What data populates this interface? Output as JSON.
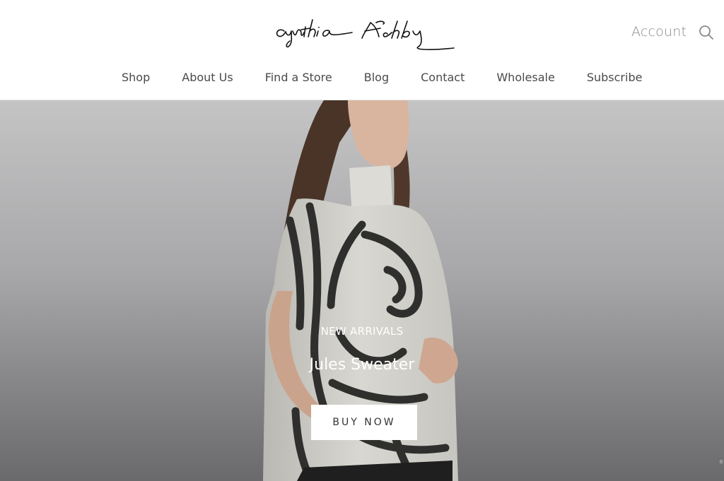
{
  "brand": {
    "logo_text": "cynthia Ashby"
  },
  "header": {
    "account_label": "Account",
    "search_icon": "search-icon"
  },
  "nav": {
    "items": [
      {
        "label": "Shop"
      },
      {
        "label": "About Us"
      },
      {
        "label": "Find a Store"
      },
      {
        "label": "Blog"
      },
      {
        "label": "Contact"
      },
      {
        "label": "Wholesale"
      },
      {
        "label": "Subscribe"
      }
    ]
  },
  "hero": {
    "eyebrow": "NEW ARRIVALS",
    "title": "Jules Sweater",
    "cta_label": "BUY NOW",
    "image_description": "model-wearing-printed-sweater",
    "colors": {
      "text": "#ffffff",
      "cta_background": "#ffffff",
      "cta_text": "#333333"
    }
  },
  "colors": {
    "nav_text": "#4a4a4a",
    "account_text": "#8a8a8a"
  }
}
